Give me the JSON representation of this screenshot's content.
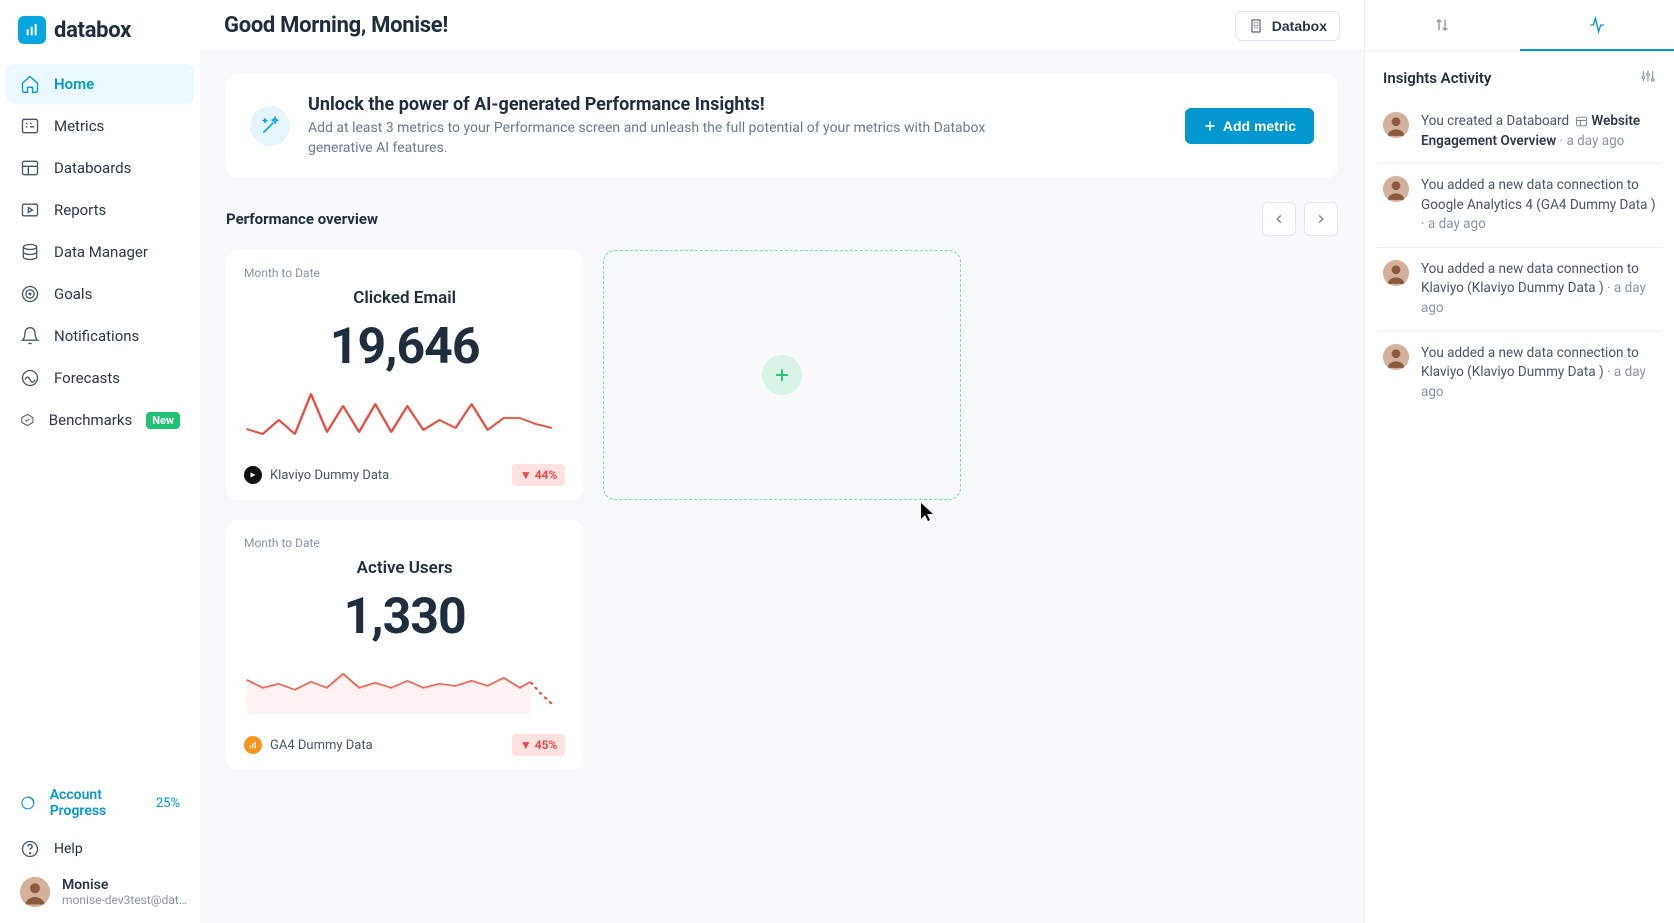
{
  "brand": {
    "name": "databox"
  },
  "greeting": "Good Morning, Monise!",
  "account_button_label": "Databox",
  "sidebar": {
    "items": [
      {
        "label": "Home"
      },
      {
        "label": "Metrics"
      },
      {
        "label": "Databoards"
      },
      {
        "label": "Reports"
      },
      {
        "label": "Data Manager"
      },
      {
        "label": "Goals"
      },
      {
        "label": "Notifications"
      },
      {
        "label": "Forecasts"
      },
      {
        "label": "Benchmarks",
        "badge": "New"
      }
    ],
    "account_progress_label": "Account Progress",
    "account_progress_pct": "25%",
    "help_label": "Help",
    "user": {
      "name": "Monise",
      "email": "monise-dev3test@datab…"
    }
  },
  "banner": {
    "title": "Unlock the power of AI-generated Performance Insights!",
    "subtitle": "Add at least 3 metrics to your Performance screen and unleash the full potential of your metrics with Databox generative AI features.",
    "cta": "Add metric"
  },
  "performance": {
    "section_title": "Performance overview",
    "cards": [
      {
        "period": "Month to Date",
        "title": "Clicked Email",
        "value": "19,646",
        "delta": "▼ 44%",
        "source": "Klaviyo Dummy Data",
        "source_color": "black"
      },
      {
        "period": "Month to Date",
        "title": "Active Users",
        "value": "1,330",
        "delta": "▼ 45%",
        "source": "GA4 Dummy Data",
        "source_color": "orange"
      }
    ]
  },
  "insights": {
    "panel_title": "Insights Activity",
    "items": [
      {
        "text_a": "You created a Databoard ",
        "link": "Website Engagement Overview",
        "time": "a day ago",
        "show_icon": true
      },
      {
        "text_a": "You added a new data connection to Google Analytics 4 (GA4 Dummy Data )",
        "link": "",
        "time": "a day ago"
      },
      {
        "text_a": "You added a new data connection to Klaviyo (Klaviyo Dummy Data )",
        "link": "",
        "time": "a day ago"
      },
      {
        "text_a": "You added a new data connection to Klaviyo (Klaviyo Dummy Data )",
        "link": "",
        "time": "a day ago"
      }
    ]
  },
  "chart_data": [
    {
      "type": "line",
      "title": "Clicked Email",
      "ylabel": "",
      "note": "values estimated from sparkline pixels",
      "values": [
        600,
        400,
        900,
        400,
        1800,
        500,
        1300,
        500,
        1500,
        500,
        1400,
        600,
        900,
        700,
        1500,
        600,
        1000,
        1000,
        800,
        700
      ]
    },
    {
      "type": "line",
      "title": "Active Users",
      "ylabel": "",
      "note": "values estimated from sparkline pixels; last segment dashed (forecast)",
      "values": [
        80,
        60,
        70,
        55,
        75,
        60,
        90,
        60,
        72,
        60,
        78,
        60,
        70,
        65,
        78,
        65,
        85,
        60,
        75,
        40
      ]
    }
  ]
}
